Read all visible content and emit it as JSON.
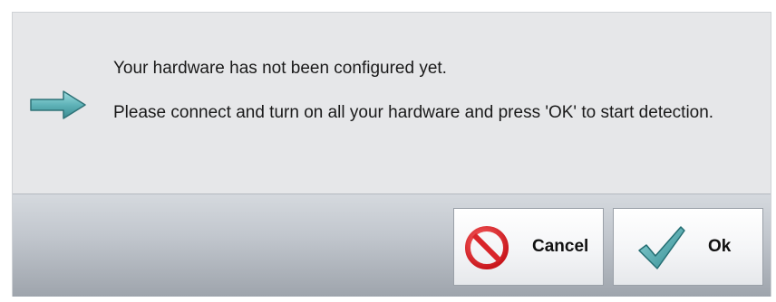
{
  "message": {
    "line1": "Your hardware has not been configured yet.",
    "line2": "Please connect and turn on all your hardware and press 'OK' to start detection.",
    "icon": "arrow-right-icon"
  },
  "buttons": {
    "cancel": {
      "label": "Cancel",
      "icon": "cancel-icon"
    },
    "ok": {
      "label": "Ok",
      "icon": "checkmark-icon"
    }
  },
  "colors": {
    "arrow": "#5fb3b8",
    "cancel_icon": "#d9252a",
    "checkmark": "#4aa3a8"
  }
}
